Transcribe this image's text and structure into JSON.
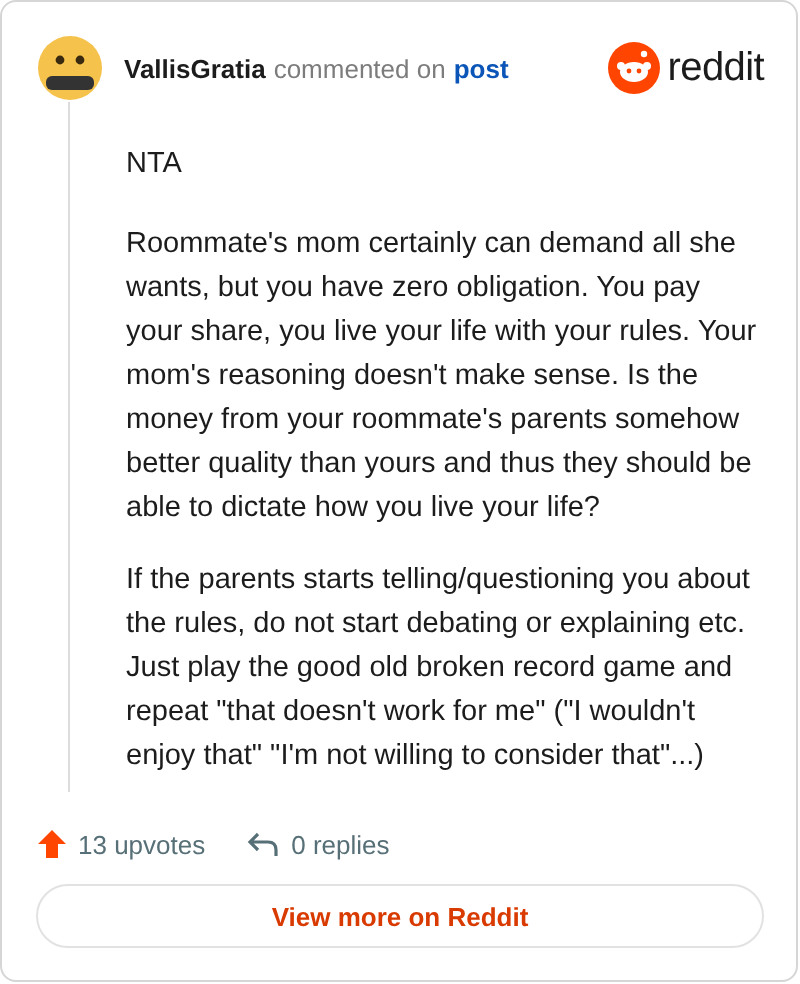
{
  "header": {
    "username": "VallisGratia",
    "action": "commented on",
    "link": "post",
    "brand": "reddit"
  },
  "paragraphs": [
    "NTA",
    "Roommate's mom certainly can demand all she wants, but you have zero obligation. You pay your share, you live your life with your rules. Your mom's reasoning doesn't make sense. Is the money from your roommate's parents somehow better quality than yours and thus they should be able to dictate how you live your life?",
    "If the parents starts telling/questioning you about the rules, do not start debating or explaining etc. Just play the good old broken record game and repeat \"that doesn't work for me\" (\"I wouldn't enjoy that\" \"I'm not willing to consider that\"...)"
  ],
  "footer": {
    "upvotes": "13 upvotes",
    "replies": "0 replies"
  },
  "button": "View more on Reddit"
}
